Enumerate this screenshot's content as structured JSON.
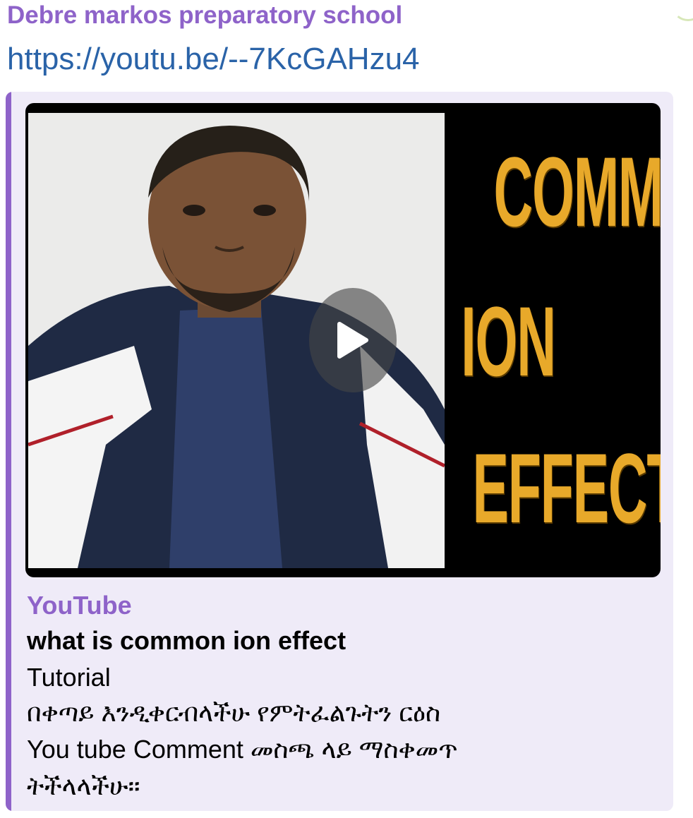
{
  "message": {
    "sender": "Debre markos preparatory school",
    "link_text": "https://youtu.be/--7KcGAHzu4"
  },
  "preview": {
    "site_name": "YouTube",
    "title": "what is common ion effect",
    "description_lines": [
      "Tutorial",
      "በቀጣይ እንዲቀርብላችሁ የምትፈልጉትን ርዕስ",
      "You tube Comment  መስጫ ላይ ማስቀመጥ",
      "ትችላላችሁ።"
    ],
    "thumbnail_words": [
      "COMMON",
      "ION",
      "EFFECT"
    ],
    "accent_color": "#8e63c9",
    "link_color": "#2a63a8",
    "card_background": "#efebf8",
    "thumbnail_text_color": "#e8a92a"
  },
  "icons": {
    "play": "play-icon",
    "photo": "person-photo"
  }
}
